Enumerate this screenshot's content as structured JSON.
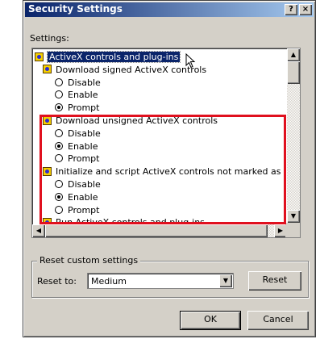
{
  "window": {
    "title": "Security Settings",
    "help_label": "?",
    "close_label": "×"
  },
  "settings_label": "Settings:",
  "tree": [
    {
      "kind": "group",
      "label": "ActiveX controls and plug-ins",
      "selected": true
    },
    {
      "kind": "group",
      "label": "Download signed ActiveX controls"
    },
    {
      "kind": "option",
      "label": "Disable",
      "checked": false
    },
    {
      "kind": "option",
      "label": "Enable",
      "checked": false
    },
    {
      "kind": "option",
      "label": "Prompt",
      "checked": true
    },
    {
      "kind": "group",
      "label": "Download unsigned ActiveX controls"
    },
    {
      "kind": "option",
      "label": "Disable",
      "checked": false
    },
    {
      "kind": "option",
      "label": "Enable",
      "checked": true
    },
    {
      "kind": "option",
      "label": "Prompt",
      "checked": false
    },
    {
      "kind": "group",
      "label": "Initialize and script ActiveX controls not marked as safe"
    },
    {
      "kind": "option",
      "label": "Disable",
      "checked": false
    },
    {
      "kind": "option",
      "label": "Enable",
      "checked": true
    },
    {
      "kind": "option",
      "label": "Prompt",
      "checked": false
    },
    {
      "kind": "group",
      "label": "Run ActiveX controls and plug-ins",
      "cut_off": true
    }
  ],
  "reset": {
    "group_label": "Reset custom settings",
    "reset_to_label": "Reset to:",
    "selected_level": "Medium",
    "reset_button": "Reset"
  },
  "buttons": {
    "ok": "OK",
    "cancel": "Cancel"
  },
  "colors": {
    "highlight_box": "#e0101e",
    "title_bar": "#0a246a",
    "selection": "#0a246a"
  }
}
